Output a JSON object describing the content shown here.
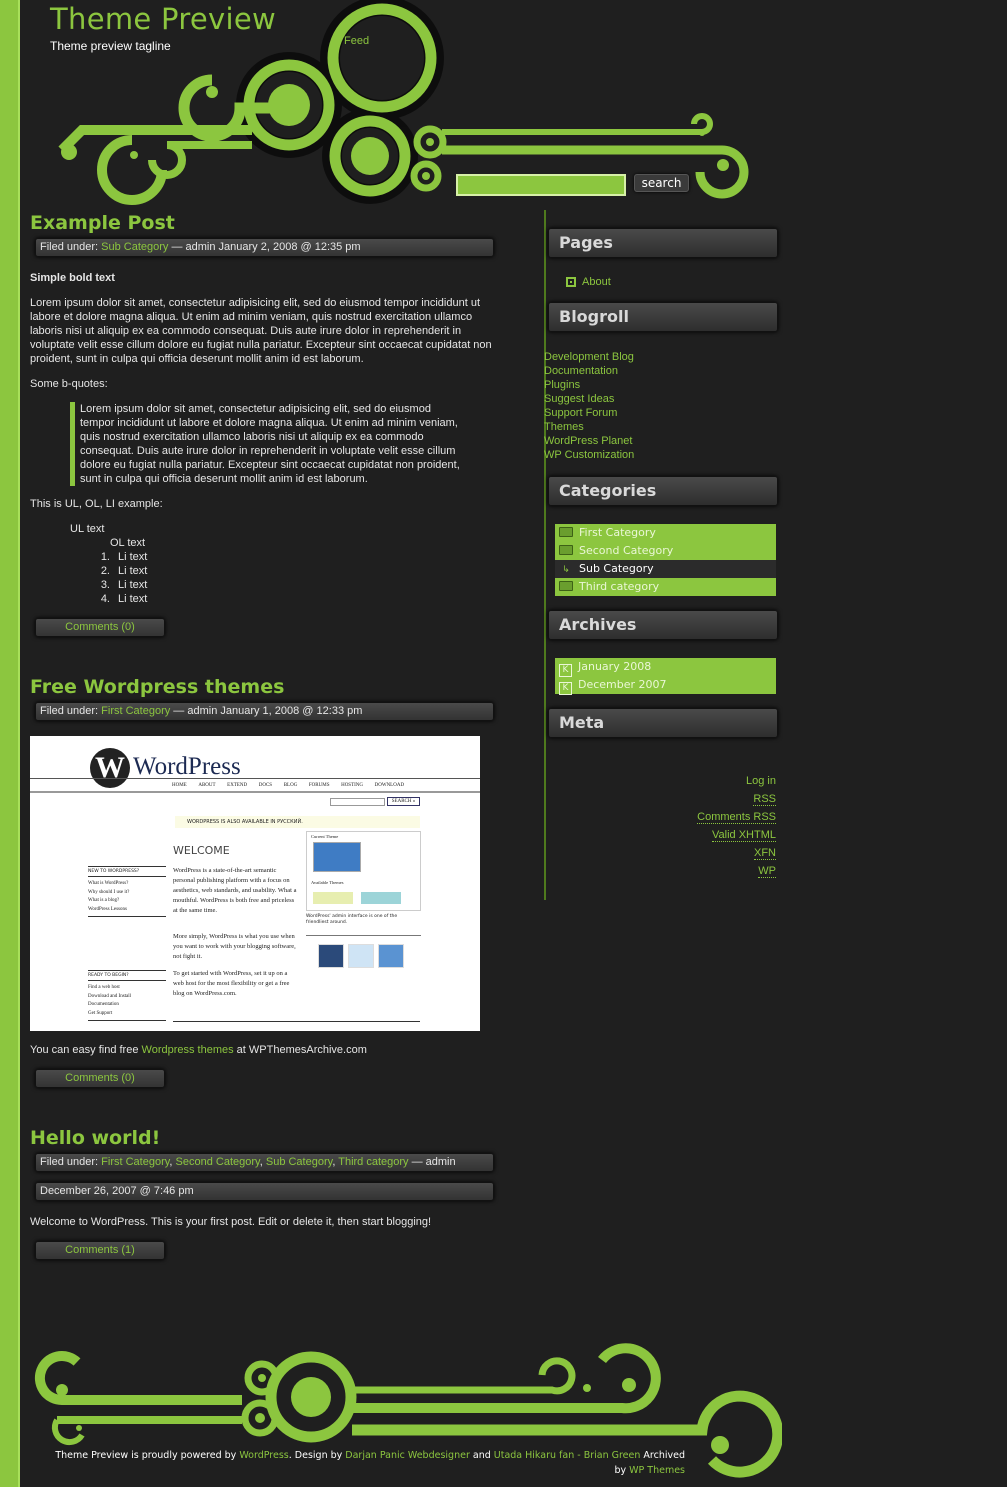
{
  "header": {
    "site_title": "Theme Preview",
    "tagline": "Theme preview tagline",
    "feed_label": "Feed",
    "search": {
      "value": "",
      "placeholder": "",
      "button_label": "search"
    }
  },
  "posts": [
    {
      "title": "Example Post",
      "meta": {
        "prefix": "Filed under: ",
        "categories": [
          "Sub Category"
        ],
        "suffix": " — admin January 2, 2008 @ 12:35 pm"
      },
      "bold_text": "Simple bold text",
      "paragraph": "Lorem ipsum dolor sit amet, consectetur adipisicing elit, sed do eiusmod tempor incididunt ut labore et dolore magna aliqua. Ut enim ad minim veniam, quis nostrud exercitation ullamco laboris nisi ut aliquip ex ea commodo consequat. Duis aute irure dolor in reprehenderit in voluptate velit esse cillum dolore eu fugiat nulla pariatur. Excepteur sint occaecat cupidatat non proident, sunt in culpa qui officia deserunt mollit anim id est laborum.",
      "bquote_intro": "Some b-quotes:",
      "blockquote": "Lorem ipsum dolor sit amet, consectetur adipisicing elit, sed do eiusmod tempor incididunt ut labore et dolore magna aliqua. Ut enim ad minim veniam, quis nostrud exercitation ullamco laboris nisi ut aliquip ex ea commodo consequat. Duis aute irure dolor in reprehenderit in voluptate velit esse cillum dolore eu fugiat nulla pariatur. Excepteur sint occaecat cupidatat non proident, sunt in culpa qui officia deserunt mollit anim id est laborum.",
      "list_intro": "This is UL, OL, LI example:",
      "ul_text": "UL text",
      "ol_text": "OL text",
      "li_items": [
        "Li text",
        "Li text",
        "Li text",
        "Li text"
      ],
      "comments_label": "Comments (0)"
    },
    {
      "title": "Free Wordpress themes",
      "meta": {
        "prefix": "Filed under: ",
        "categories": [
          "First Category"
        ],
        "suffix": " — admin January 1, 2008 @ 12:33 pm"
      },
      "body_prefix": "You can easy find free ",
      "body_link": "Wordpress themes",
      "body_suffix": " at WPThemesArchive.com",
      "comments_label": "Comments (0)",
      "image": {
        "logo_text": "WordPress",
        "nav": [
          "HOME",
          "ABOUT",
          "EXTEND",
          "DOCS",
          "BLOG",
          "FORUMS",
          "HOSTING",
          "DOWNLOAD"
        ],
        "search_button": "SEARCH »",
        "notice": "WORDPRESS IS ALSO AVAILABLE IN РУССКИЙ.",
        "welcome": "WELCOME",
        "new_heading": "NEW TO WORDPRESS?",
        "new_links": [
          "What is WordPress?",
          "Why should I use it?",
          "What is a blog?",
          "WordPress Lessons"
        ],
        "ready_heading": "READY TO BEGIN?",
        "ready_links": [
          "Find a web host",
          "Download and Install",
          "Documentation",
          "Get Support"
        ],
        "para1": "WordPress is a state-of-the-art semantic personal publishing platform with a focus on aesthetics, web standards, and usability. What a mouthful. WordPress is both free and priceless at the same time.",
        "para2": "More simply, WordPress is what you use when you want to work with your blogging software, not fight it.",
        "para3": "To get started with WordPress, set it up on a web host for the most flexibility or get a free blog on WordPress.com.",
        "current_theme": "Current Theme",
        "available_themes": "Available Themes",
        "caption": "WordPress' admin interface is one of the friendliest around."
      }
    },
    {
      "title": "Hello world!",
      "meta": {
        "prefix": "Filed under: ",
        "categories": [
          "First Category",
          "Second Category",
          "Sub Category",
          "Third category"
        ],
        "suffix": " — admin"
      },
      "date": "December 26, 2007 @ 7:46 pm",
      "body": "Welcome to WordPress. This is your first post. Edit or delete it, then start blogging!",
      "comments_label": "Comments (1)"
    }
  ],
  "sidebar": {
    "pages": {
      "title": "Pages",
      "items": [
        "About"
      ]
    },
    "blogroll": {
      "title": "Blogroll",
      "items": [
        "Development Blog",
        "Documentation",
        "Plugins",
        "Suggest Ideas",
        "Support Forum",
        "Themes",
        "WordPress Planet",
        "WP Customization"
      ]
    },
    "categories": {
      "title": "Categories",
      "items": [
        {
          "label": "First Category",
          "sub": false
        },
        {
          "label": "Second Category",
          "sub": false
        },
        {
          "label": "Sub Category",
          "sub": true
        },
        {
          "label": "Third category",
          "sub": false
        }
      ]
    },
    "archives": {
      "title": "Archives",
      "items": [
        "January 2008",
        "December 2007"
      ]
    },
    "meta": {
      "title": "Meta",
      "items": [
        "Log in",
        "RSS",
        "Comments RSS",
        "Valid XHTML",
        "XFN",
        "WP"
      ]
    }
  },
  "footer": {
    "text1": "Theme Preview is proudly powered by ",
    "link1": "WordPress",
    "text2": ". Design by ",
    "link2": "Darjan Panic Webdesigner",
    "text3": " and ",
    "link3": "Utada Hikaru fan - Brian Green",
    "text4": " Archived by ",
    "link4": "WP Themes"
  },
  "colors": {
    "accent": "#8cc63f",
    "background": "#1f1f1f",
    "bar": "#333333"
  }
}
